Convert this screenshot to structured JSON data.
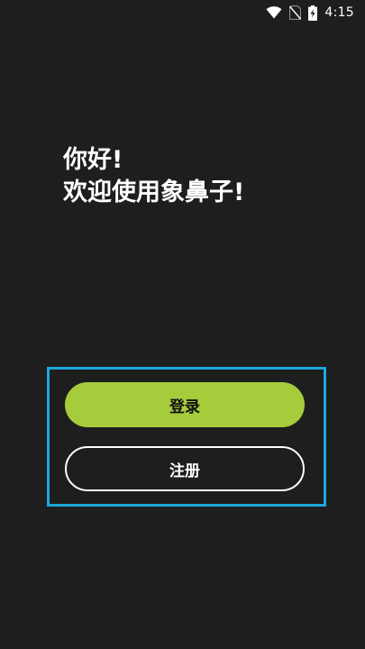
{
  "status_bar": {
    "time": "4:15",
    "icons": [
      "wifi-icon",
      "no-sim-icon",
      "battery-charging-icon"
    ]
  },
  "greeting": {
    "line1": "你好!",
    "line2": "欢迎使用象鼻子!"
  },
  "actions": {
    "login_label": "登录",
    "register_label": "注册"
  },
  "colors": {
    "background": "#1e1e1e",
    "accent": "#a6cc3b",
    "highlight_border": "#1ba8e0",
    "text": "#ffffff"
  }
}
